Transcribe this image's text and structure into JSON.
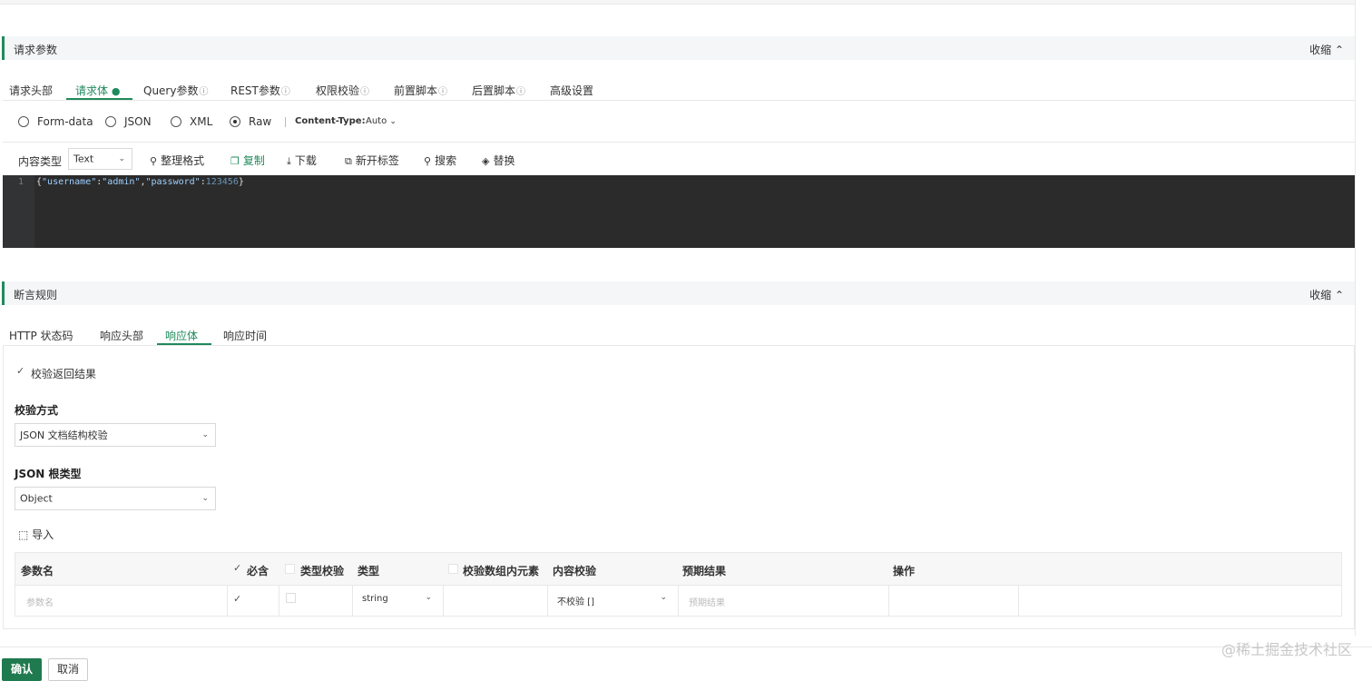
{
  "request_section": {
    "title": "请求参数",
    "collapse": "收缩 ⌃",
    "tabs": [
      {
        "label": "请求头部"
      },
      {
        "label": "请求体"
      },
      {
        "label": "Query参数",
        "info": "ⓘ"
      },
      {
        "label": "REST参数",
        "info": "ⓘ"
      },
      {
        "label": "权限校验",
        "info": "ⓘ"
      },
      {
        "label": "前置脚本",
        "info": "ⓘ"
      },
      {
        "label": "后置脚本",
        "info": "ⓘ"
      },
      {
        "label": "高级设置"
      }
    ],
    "body_types": [
      "Form-data",
      "JSON",
      "XML",
      "Raw"
    ],
    "selected_body_type": "Raw",
    "content_type_label": "Content-Type:",
    "content_type_value": "Auto",
    "content_kind_label": "内容类型",
    "content_kind_value": "Text",
    "tools": {
      "format": "整理格式",
      "copy": "复制",
      "download": "下载",
      "new_tab": "新开标签",
      "search": "搜索",
      "replace": "替换"
    },
    "editor": {
      "line_number": "1",
      "tokens": {
        "open": "{",
        "k1": "\"username\"",
        "colon1": ":",
        "v1": "\"admin\"",
        "comma": ",",
        "k2": "\"password\"",
        "colon2": ":",
        "v2": "123456",
        "close": "}"
      }
    }
  },
  "assert_section": {
    "title": "断言规则",
    "collapse": "收缩 ⌃",
    "tabs": [
      {
        "label": "HTTP 状态码"
      },
      {
        "label": "响应头部"
      },
      {
        "label": "响应体"
      },
      {
        "label": "响应时间"
      }
    ],
    "verify_result_label": "校验返回结果",
    "verify_method_label": "校验方式",
    "verify_method_value": "JSON 文档结构校验",
    "root_type_label": "JSON 根类型",
    "root_type_value": "Object",
    "import_label": "导入",
    "table": {
      "headers": {
        "name": "参数名",
        "required": "必含",
        "type_check": "类型校验",
        "type": "类型",
        "array_check": "校验数组内元素",
        "content_check": "内容校验",
        "expected": "预期结果",
        "action": "操作"
      },
      "row": {
        "name_placeholder": "参数名",
        "type_value": "string",
        "content_check_value": "不校验 []",
        "expected_placeholder": "预期结果"
      }
    }
  },
  "footer": {
    "confirm": "确认",
    "cancel": "取消"
  },
  "watermark": "@稀土掘金技术社区",
  "colors": {
    "accent": "#1f8a5c",
    "confirm_bg": "#1f7a4f",
    "editor_bg": "#2b2b2b"
  }
}
